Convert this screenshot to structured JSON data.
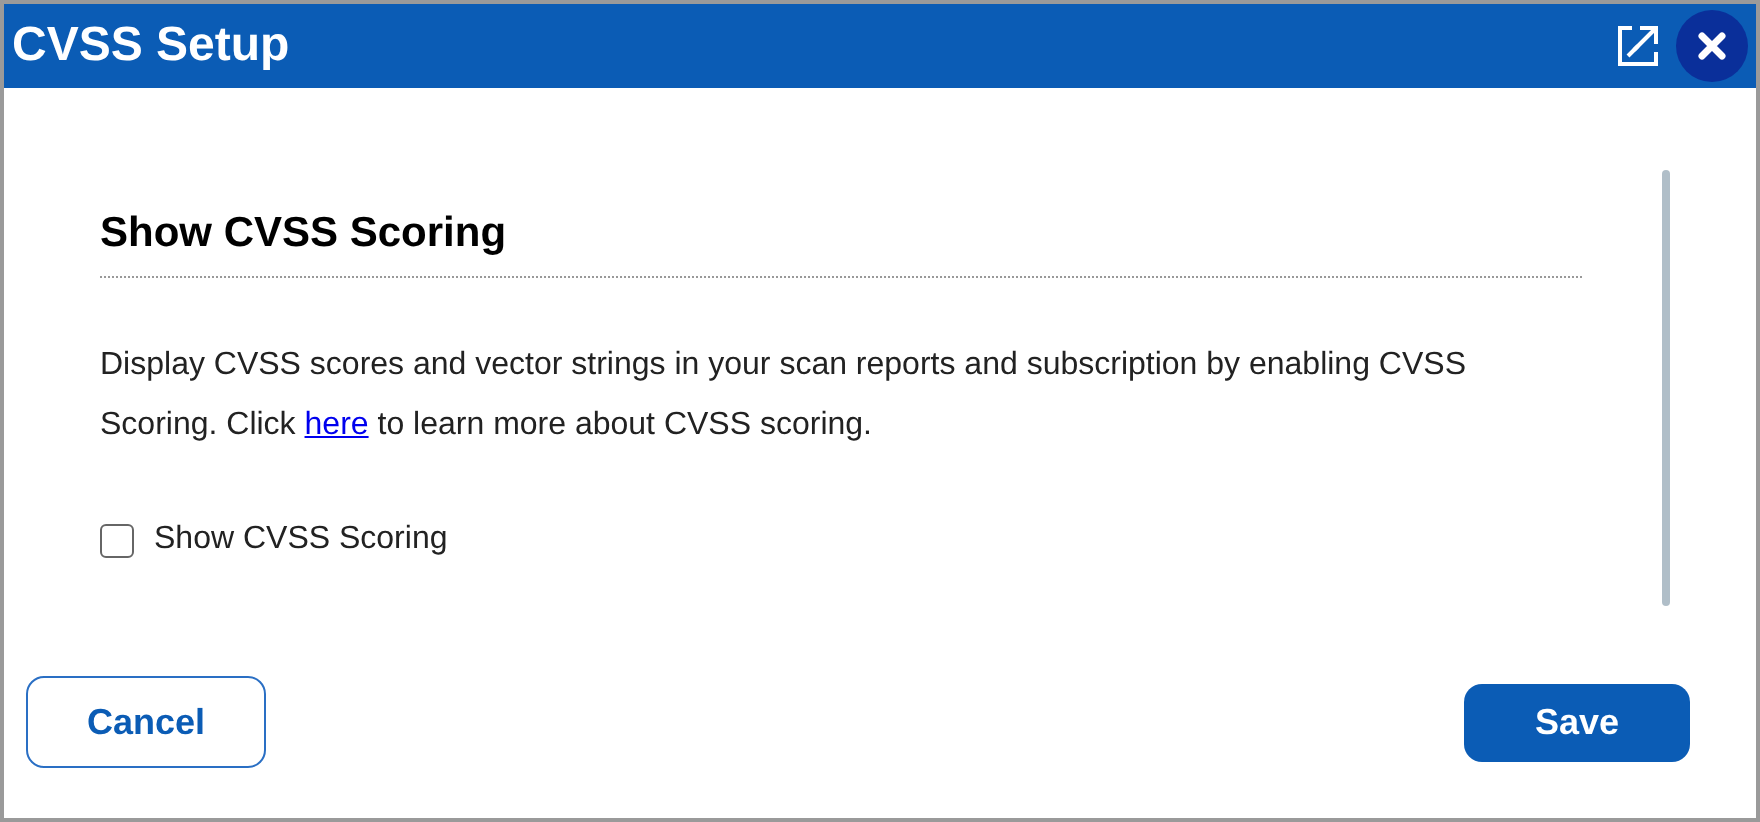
{
  "window": {
    "title": "CVSS Setup"
  },
  "section": {
    "heading": "Show CVSS Scoring",
    "description_before": "Display CVSS scores and vector strings in your scan reports and subscription by enabling CVSS Scoring. Click",
    "link": "here",
    "description_after": "to learn more about CVSS scoring."
  },
  "checkbox": {
    "label": "Show CVSS Scoring",
    "checked": false
  },
  "buttons": [
    {
      "label": "Cancel",
      "kind": "secondary"
    },
    {
      "label": "Save",
      "kind": "primary"
    }
  ]
}
